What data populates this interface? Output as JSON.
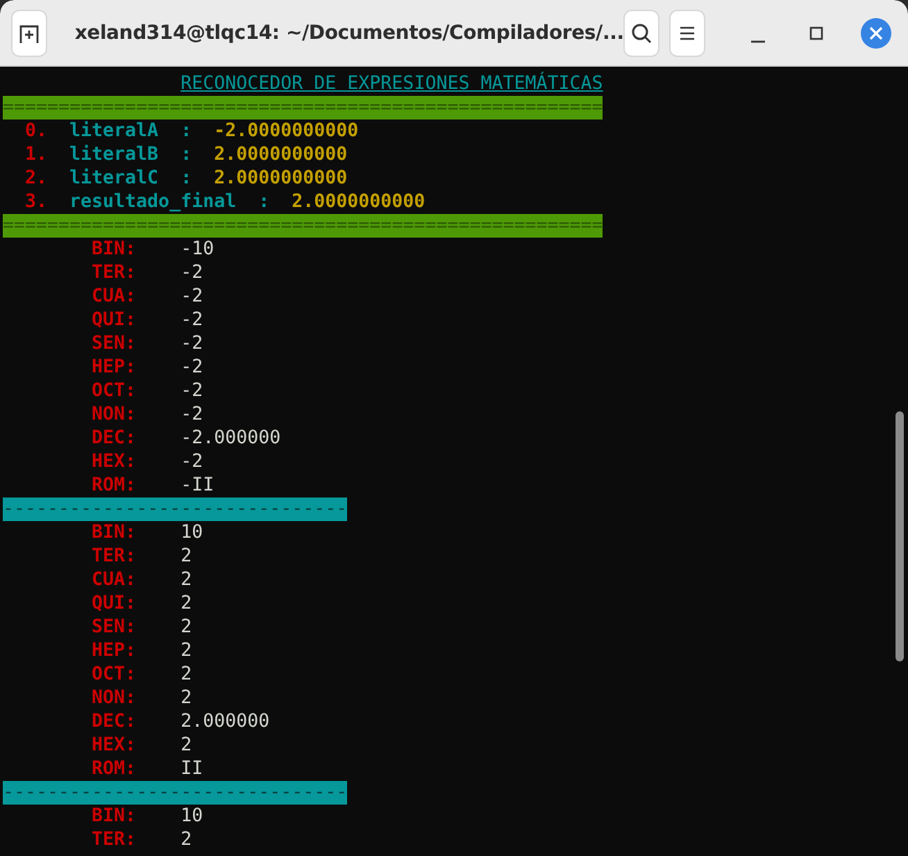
{
  "window": {
    "title": "xeland314@tlqc14: ~/Documentos/Compiladores/..."
  },
  "terminal": {
    "heading": "RECONOCEDOR DE EXPRESIONES MATEMÁTICAS",
    "lines": [
      {
        "kind": "double_rule",
        "text": "======================================================"
      },
      {
        "kind": "literal",
        "index": "0.",
        "name": "literalA  :",
        "value": "-2.0000000000"
      },
      {
        "kind": "literal",
        "index": "1.",
        "name": "literalB  :",
        "value": "2.0000000000"
      },
      {
        "kind": "literal",
        "index": "2.",
        "name": "literalC  :",
        "value": "2.0000000000"
      },
      {
        "kind": "literal",
        "index": "3.",
        "name": "resultado_final  :",
        "value": "2.0000000000"
      },
      {
        "kind": "double_rule",
        "text": "======================================================"
      },
      {
        "kind": "conv",
        "label": "BIN:",
        "value": "-10"
      },
      {
        "kind": "conv",
        "label": "TER:",
        "value": "-2"
      },
      {
        "kind": "conv",
        "label": "CUA:",
        "value": "-2"
      },
      {
        "kind": "conv",
        "label": "QUI:",
        "value": "-2"
      },
      {
        "kind": "conv",
        "label": "SEN:",
        "value": "-2"
      },
      {
        "kind": "conv",
        "label": "HEP:",
        "value": "-2"
      },
      {
        "kind": "conv",
        "label": "OCT:",
        "value": "-2"
      },
      {
        "kind": "conv",
        "label": "NON:",
        "value": "-2"
      },
      {
        "kind": "conv",
        "label": "DEC:",
        "value": "-2.000000"
      },
      {
        "kind": "conv",
        "label": "HEX:",
        "value": "-2"
      },
      {
        "kind": "conv",
        "label": "ROM:",
        "value": "-II"
      },
      {
        "kind": "single_rule",
        "text": "-------------------------------"
      },
      {
        "kind": "conv",
        "label": "BIN:",
        "value": "10"
      },
      {
        "kind": "conv",
        "label": "TER:",
        "value": "2"
      },
      {
        "kind": "conv",
        "label": "CUA:",
        "value": "2"
      },
      {
        "kind": "conv",
        "label": "QUI:",
        "value": "2"
      },
      {
        "kind": "conv",
        "label": "SEN:",
        "value": "2"
      },
      {
        "kind": "conv",
        "label": "HEP:",
        "value": "2"
      },
      {
        "kind": "conv",
        "label": "OCT:",
        "value": "2"
      },
      {
        "kind": "conv",
        "label": "NON:",
        "value": "2"
      },
      {
        "kind": "conv",
        "label": "DEC:",
        "value": "2.000000"
      },
      {
        "kind": "conv",
        "label": "HEX:",
        "value": "2"
      },
      {
        "kind": "conv",
        "label": "ROM:",
        "value": "II"
      },
      {
        "kind": "single_rule",
        "text": "-------------------------------"
      },
      {
        "kind": "conv",
        "label": "BIN:",
        "value": "10"
      },
      {
        "kind": "conv",
        "label": "TER:",
        "value": "2"
      }
    ]
  }
}
